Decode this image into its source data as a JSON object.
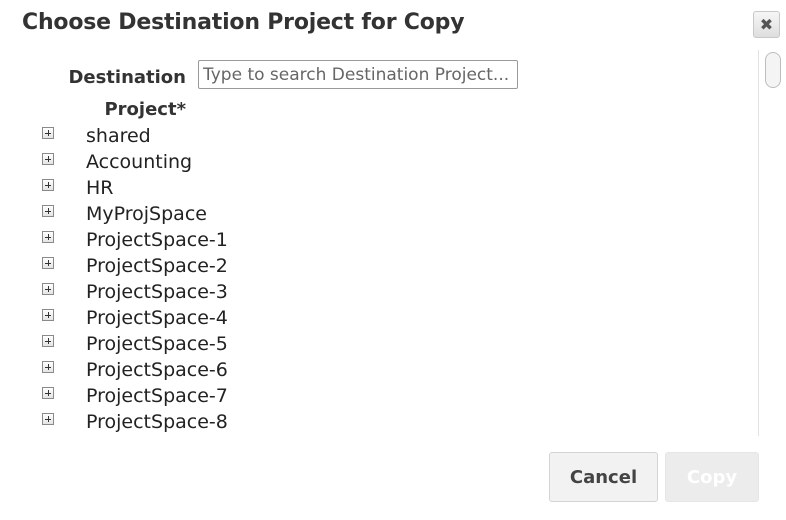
{
  "dialog": {
    "title": "Choose Destination Project for Copy",
    "close_label": "✖"
  },
  "destination": {
    "label": "Destination Project*",
    "placeholder": "Type to search Destination Project..."
  },
  "tree": {
    "items": [
      {
        "label": "shared"
      },
      {
        "label": "Accounting"
      },
      {
        "label": "HR"
      },
      {
        "label": "MyProjSpace"
      },
      {
        "label": "ProjectSpace-1"
      },
      {
        "label": "ProjectSpace-2"
      },
      {
        "label": "ProjectSpace-3"
      },
      {
        "label": "ProjectSpace-4"
      },
      {
        "label": "ProjectSpace-5"
      },
      {
        "label": "ProjectSpace-6"
      },
      {
        "label": "ProjectSpace-7"
      },
      {
        "label": "ProjectSpace-8"
      }
    ]
  },
  "buttons": {
    "cancel_label": "Cancel",
    "copy_label": "Copy"
  },
  "icons": {
    "close": "close-icon",
    "expand": "plus-box-icon"
  },
  "colors": {
    "disabled_button_bg": "#ececec",
    "disabled_button_text": "#ffffff"
  }
}
